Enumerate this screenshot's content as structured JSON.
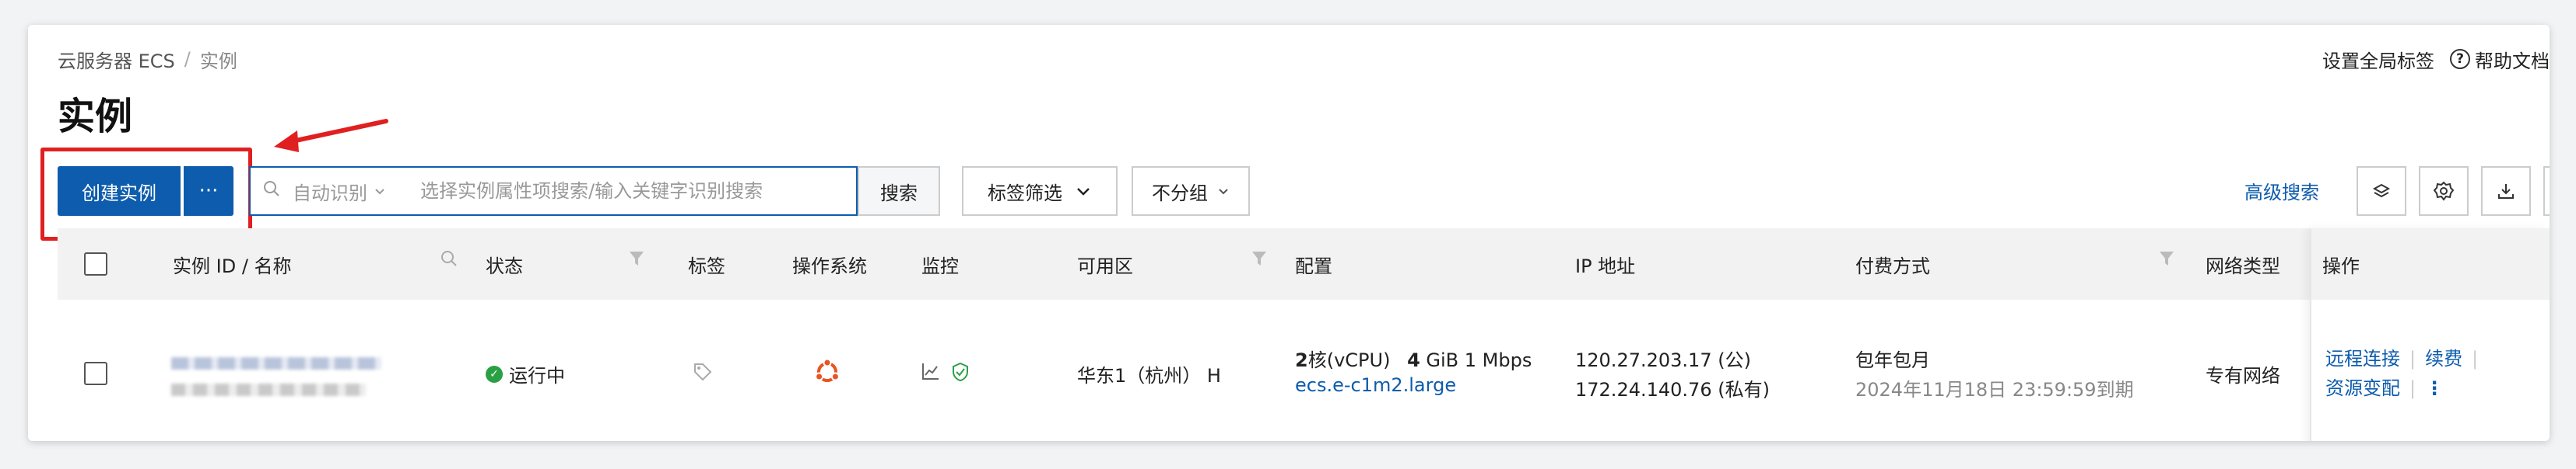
{
  "breadcrumb": {
    "root": "云服务器 ECS",
    "separator": "/",
    "current": "实例"
  },
  "top_right": {
    "set_tags": "设置全局标签",
    "help_icon": "?",
    "help": "帮助文档"
  },
  "page_title": "实例",
  "toolbar": {
    "create_label": "创建实例",
    "more_label": "···",
    "search_mode": "自动识别",
    "search_placeholder": "选择实例属性项搜索/输入关键字识别搜索",
    "search_button": "搜索",
    "tag_filter": "标签筛选",
    "group_select": "不分组",
    "advanced_search": "高级搜索"
  },
  "table": {
    "columns": [
      "实例 ID / 名称",
      "状态",
      "标签",
      "操作系统",
      "监控",
      "可用区",
      "配置",
      "IP 地址",
      "付费方式",
      "网络类型",
      "操作"
    ],
    "rows": [
      {
        "status": "运行中",
        "zone": "华东1（杭州） H",
        "config_core": "2",
        "config_core_suffix": "核(vCPU)",
        "config_mem": "4",
        "config_mem_suffix": " GiB 1 Mbps",
        "instance_type": "ecs.e-c1m2.large",
        "public_ip": "120.27.203.17 (公)",
        "private_ip": "172.24.140.76 (私有)",
        "billing": "包年包月",
        "expire": "2024年11月18日 23:59:59到期",
        "network": "专有网络",
        "actions": [
          "远程连接",
          "续费",
          "资源变配"
        ],
        "more_icon": "⋮"
      }
    ]
  },
  "colors": {
    "primary": "#0d5cad",
    "highlight": "#e02020",
    "status_running": "#2aa044",
    "os_ubuntu": "#e95420"
  }
}
